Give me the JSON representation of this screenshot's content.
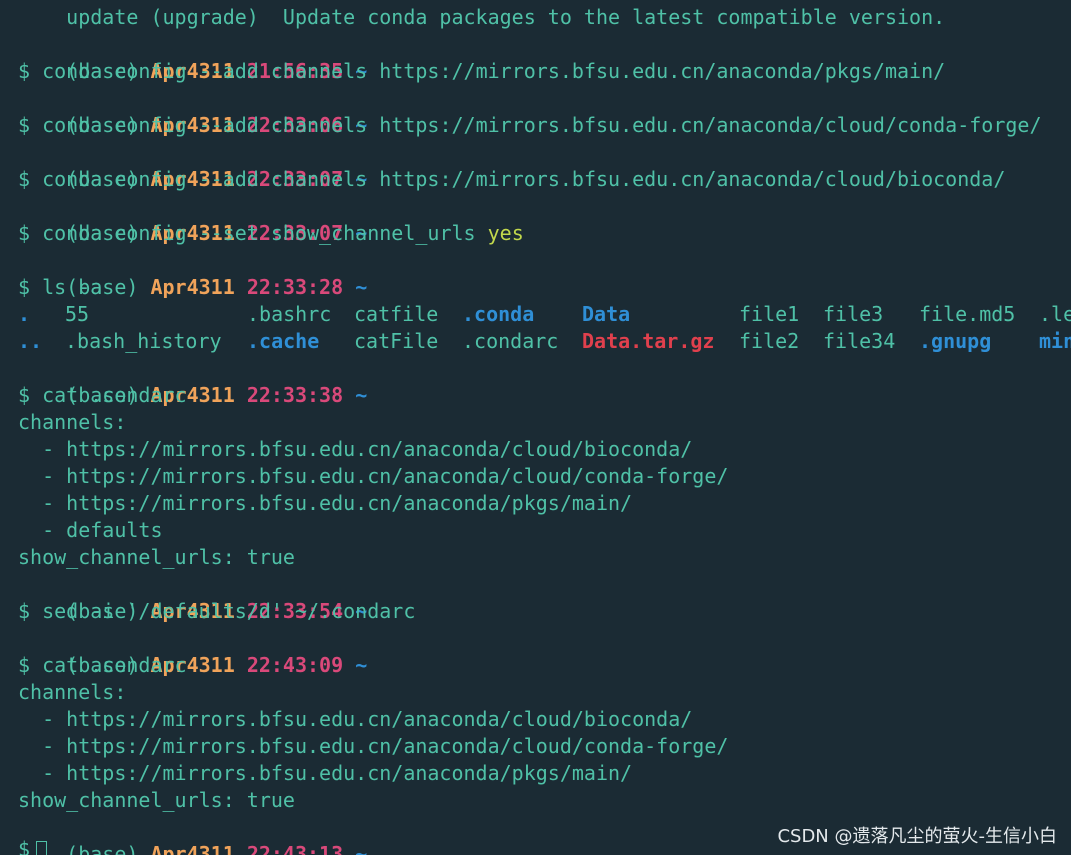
{
  "colors": {
    "background": "#1b2b34",
    "text": "#4fc1a7",
    "user": "#f0a35a",
    "time": "#d9497a",
    "directory": "#2f8fd6",
    "archive": "#e0404d",
    "yes": "#c2d94c"
  },
  "top_partial_line": "    update (upgrade)  Update conda packages to the latest compatible version.",
  "prompt": {
    "env": "(base)",
    "user": "Apr4311",
    "cwd": "~",
    "symbol": "$"
  },
  "prompts_times": [
    "21:56:35",
    "22:33:06",
    "22:33:07",
    "22:33:07",
    "22:33:28",
    "22:33:38",
    "22:33:54",
    "22:43:09",
    "22:43:13"
  ],
  "commands": [
    "conda config --add channels https://mirrors.bfsu.edu.cn/anaconda/pkgs/main/",
    "conda config --add channels https://mirrors.bfsu.edu.cn/anaconda/cloud/conda-forge/",
    "conda config --add channels https://mirrors.bfsu.edu.cn/anaconda/cloud/bioconda/",
    "conda config --set show_channel_urls ",
    "ls -a",
    "cat .condarc",
    "sed -i '/defaults/d' ~/.condarc",
    "cat .condarc"
  ],
  "yes_arg": "yes",
  "ls_row1": [
    ".",
    "55",
    ".bashrc",
    "catfile",
    ".conda",
    "Data",
    "file1",
    "file3",
    "file.md5",
    ".le"
  ],
  "ls_row2": [
    "..",
    ".bash_history",
    ".cache",
    "catFile",
    ".condarc",
    "Data.tar.gz",
    "file2",
    "file34",
    ".gnupg",
    "min"
  ],
  "condarc1": [
    "channels:",
    "  - https://mirrors.bfsu.edu.cn/anaconda/cloud/bioconda/",
    "  - https://mirrors.bfsu.edu.cn/anaconda/cloud/conda-forge/",
    "  - https://mirrors.bfsu.edu.cn/anaconda/pkgs/main/",
    "  - defaults",
    "show_channel_urls: true"
  ],
  "condarc2": [
    "channels:",
    "  - https://mirrors.bfsu.edu.cn/anaconda/cloud/bioconda/",
    "  - https://mirrors.bfsu.edu.cn/anaconda/cloud/conda-forge/",
    "  - https://mirrors.bfsu.edu.cn/anaconda/pkgs/main/",
    "show_channel_urls: true"
  ],
  "watermark": "CSDN @遗落凡尘的萤火-生信小白"
}
